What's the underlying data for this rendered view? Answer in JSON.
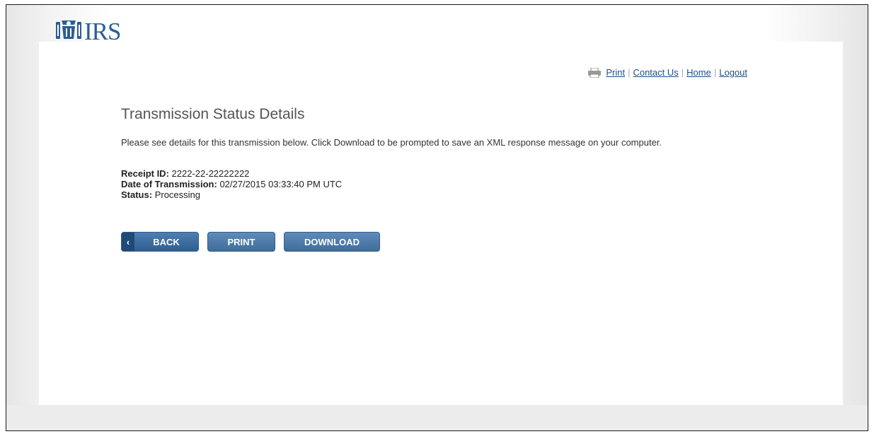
{
  "header": {
    "logo_text": "IRS"
  },
  "utility_nav": {
    "print": "Print",
    "contact_us": "Contact Us",
    "home": "Home",
    "logout": "Logout",
    "separator": "|"
  },
  "main": {
    "title": "Transmission Status Details",
    "intro": "Please see details for this transmission below. Click Download to be prompted to save an XML response message on your computer.",
    "details": {
      "receipt_label": "Receipt ID:",
      "receipt_value": "2222-22-22222222",
      "date_label": "Date of Transmission:",
      "date_value": "02/27/2015 03:33:40 PM UTC",
      "status_label": "Status:",
      "status_value": "Processing"
    }
  },
  "buttons": {
    "back": "BACK",
    "print": "PRINT",
    "download": "DOWNLOAD"
  },
  "colors": {
    "brand_blue": "#2b5e93",
    "button_blue": "#4f7eb0",
    "link_blue": "#1f4f86"
  },
  "icons": {
    "logo": "irs-eagle-icon",
    "print": "printer-icon",
    "back": "chevron-left-icon"
  }
}
